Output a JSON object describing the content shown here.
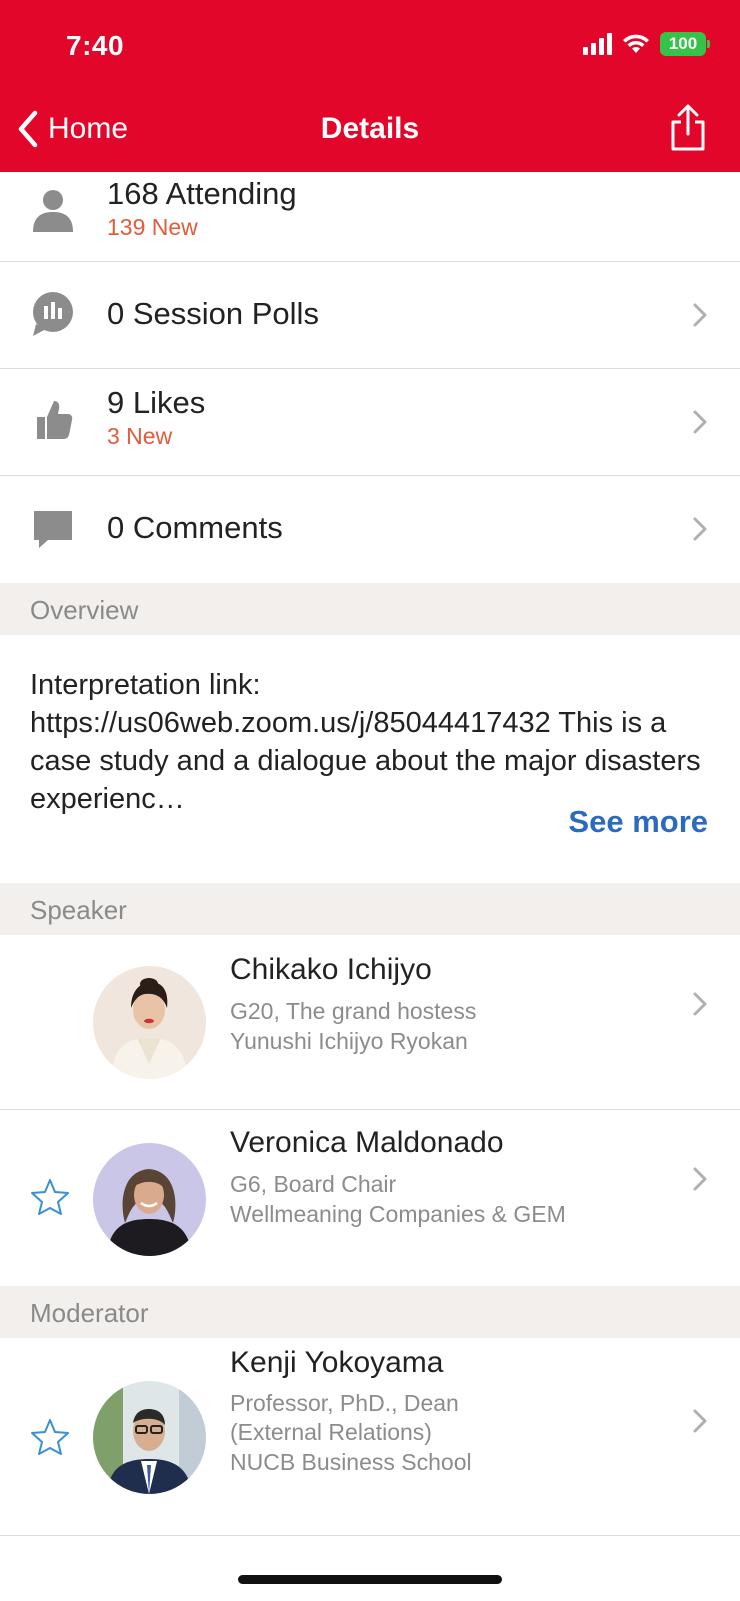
{
  "status": {
    "time": "7:40",
    "battery": "100"
  },
  "nav": {
    "back_label": "Home",
    "title": "Details"
  },
  "stats": {
    "attending": {
      "main": "168 Attending",
      "sub": "139 New"
    },
    "polls": {
      "main": "0 Session Polls"
    },
    "likes": {
      "main": "9 Likes",
      "sub": "3 New"
    },
    "comments": {
      "main": "0 Comments"
    }
  },
  "overview": {
    "heading": "Overview",
    "text": "Interpretation link: https://us06web.zoom.us/j/85044417432 This is a case study and a dialogue about the major disasters experienc…",
    "see_more": "See more"
  },
  "speakers": {
    "heading": "Speaker",
    "items": [
      {
        "name": "Chikako Ichijyo",
        "line1": "G20, The grand hostess",
        "line2": "Yunushi Ichijyo Ryokan"
      },
      {
        "name": "Veronica Maldonado",
        "line1": "G6, Board Chair",
        "line2": "Wellmeaning Companies & GEM"
      }
    ]
  },
  "moderators": {
    "heading": "Moderator",
    "items": [
      {
        "name": "Kenji Yokoyama",
        "line1": "Professor, PhD., Dean",
        "line2": "(External Relations)",
        "line3": "NUCB Business School"
      }
    ]
  },
  "colors": {
    "header": "#e2062a",
    "accent_new": "#e25c3c",
    "link": "#2a6bbf",
    "star": "#3a8fd6",
    "section_bg": "#f2efed"
  },
  "icons": [
    "chevron-left-icon",
    "share-icon",
    "person-icon",
    "poll-icon",
    "thumbs-up-icon",
    "comment-icon",
    "chevron-right-icon",
    "star-outline-icon"
  ]
}
